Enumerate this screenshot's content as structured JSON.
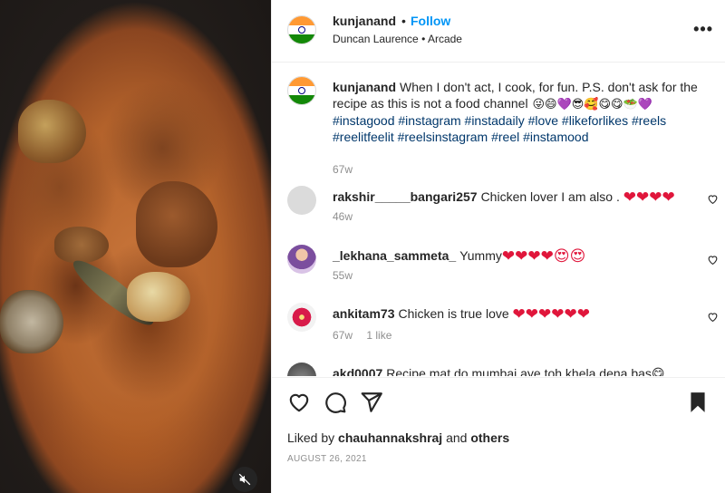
{
  "colors": {
    "follow": "#0095f6",
    "hashtag": "#00376b",
    "muted_text": "#8e8e8e",
    "heart_red": "#e0163b",
    "flag_saffron": "#FF9933",
    "flag_green": "#138808",
    "flag_chakra": "#000080"
  },
  "media": {
    "mute_icon": "speaker-muted-icon"
  },
  "header": {
    "username": "kunjanand",
    "separator": "•",
    "follow_label": "Follow",
    "location": "Duncan Laurence • Arcade",
    "more_label": "•••"
  },
  "caption": {
    "username": "kunjanand",
    "text": "When I don't act, I cook, for fun. P.S. don't ask for the recipe as this is not a food channel",
    "emojis": "😜😄💜😎🥰😋😋🥗💜",
    "hashtags_line1": "#instagood #instagram #instadaily #love #likeforlikes #reels",
    "hashtags_line2": "#reelitfeelit #reelsinstagram #reel #instamood",
    "time": "67w"
  },
  "comments": [
    {
      "username": "rakshir_____bangari257",
      "text": "Chicken lover I am also .",
      "emojis": "❤❤❤❤",
      "time": "46w",
      "likes": ""
    },
    {
      "username": "_lekhana_sammeta_",
      "text": "Yummy",
      "emojis": "❤❤❤❤😍😍",
      "time": "55w",
      "likes": ""
    },
    {
      "username": "ankitam73",
      "text": "Chicken is true love",
      "emojis": "❤❤❤❤❤❤",
      "time": "67w",
      "likes": "1 like"
    },
    {
      "username": "akd0007",
      "text": "Recipe mat do mumbai aye toh khela dena bas😋"
    }
  ],
  "actions": {
    "like_icon": "heart-icon",
    "comment_icon": "comment-icon",
    "share_icon": "share-icon",
    "save_icon": "bookmark-icon",
    "liked_by_prefix": "Liked by",
    "liked_by_user": "chauhannakshraj",
    "liked_by_and": "and",
    "liked_by_others": "others",
    "date": "AUGUST 26, 2021"
  }
}
